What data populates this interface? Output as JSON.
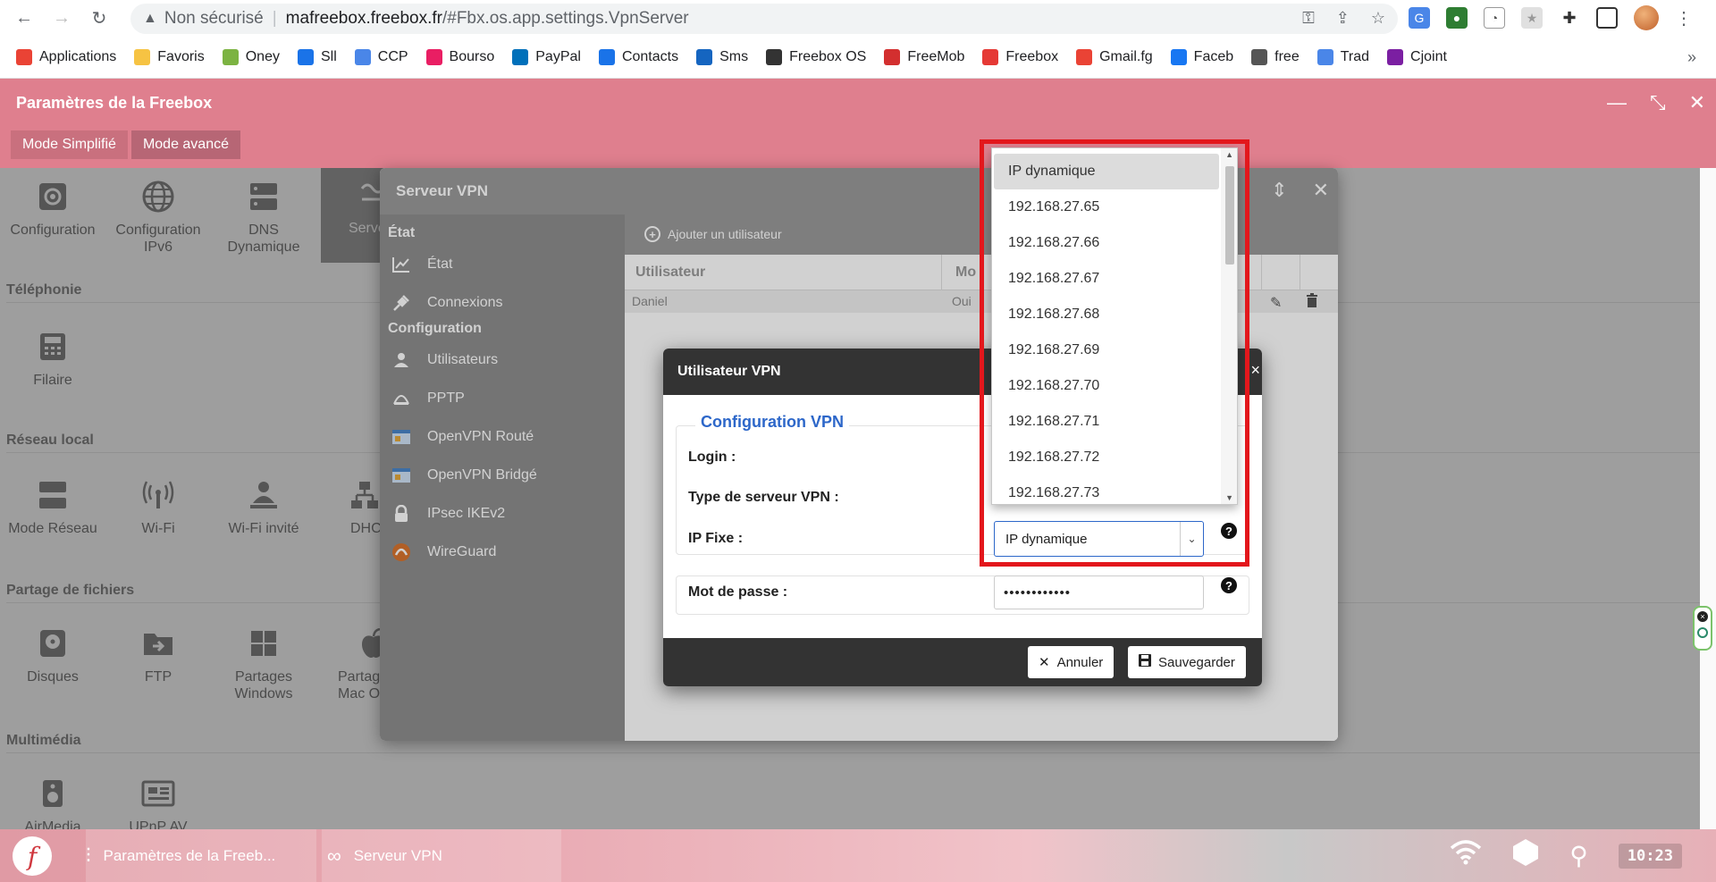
{
  "browser": {
    "insecure_label": "Non sécurisé",
    "url_host": "mafreebox.freebox.fr",
    "url_path": "/#Fbx.os.app.settings.VpnServer",
    "bookmarks": [
      "Applications",
      "Favoris",
      "Oney",
      "Sll",
      "CCP",
      "Bourso",
      "PayPal",
      "Contacts",
      "Sms",
      "Freebox OS",
      "FreeMob",
      "Freebox",
      "Gmail.fg",
      "Faceb",
      "free",
      "Trad",
      "Cjoint"
    ],
    "bookmarks_more": "»"
  },
  "app": {
    "title": "Paramètres de la Freebox",
    "mode_simple": "Mode Simplifié",
    "mode_advanced": "Mode avancé"
  },
  "settings": {
    "tiles_row1": [
      "Configuration",
      "Configuration IPv6",
      "DNS Dynamique",
      "Serveur"
    ],
    "telephony_title": "Téléphonie",
    "telephony_tiles": [
      "Filaire"
    ],
    "local_title": "Réseau local",
    "local_tiles": [
      "Mode Réseau",
      "Wi-Fi",
      "Wi-Fi invité",
      "DHC"
    ],
    "sharing_title": "Partage de fichiers",
    "sharing_tiles": [
      "Disques",
      "FTP",
      "Partages Windows",
      "Partag Mac O"
    ],
    "multimedia_title": "Multimédia",
    "multimedia_tiles": [
      "AirMedia",
      "UPnP AV"
    ]
  },
  "vpn": {
    "title": "Serveur VPN",
    "sidebar_state": "État",
    "state_items": [
      "État",
      "Connexions"
    ],
    "sidebar_config": "Configuration",
    "config_items": [
      "Utilisateurs",
      "PPTP",
      "OpenVPN Routé",
      "OpenVPN Bridgé",
      "IPsec IKEv2",
      "WireGuard"
    ],
    "add_user": "Ajouter un utilisateur",
    "col_user": "Utilisateur",
    "col_mode": "Mo",
    "row_user": "Daniel",
    "row_mode": "Oui"
  },
  "dialog": {
    "title": "Utilisateur VPN",
    "legend": "Configuration VPN",
    "login_label": "Login :",
    "server_type_label": "Type de serveur VPN :",
    "ip_label": "IP Fixe :",
    "ip_value": "IP dynamique",
    "password_label": "Mot de passe :",
    "password_value": "••••••••••••",
    "cancel": "Annuler",
    "save": "Sauvegarder",
    "close_glyph": "×"
  },
  "dropdown": {
    "options": [
      "IP dynamique",
      "192.168.27.65",
      "192.168.27.66",
      "192.168.27.67",
      "192.168.27.68",
      "192.168.27.69",
      "192.168.27.70",
      "192.168.27.71",
      "192.168.27.72",
      "192.168.27.73"
    ],
    "selected_index": 0
  },
  "taskbar": {
    "item1": "Paramètres de la Freeb...",
    "item2": "Serveur VPN",
    "clock": "10:23"
  },
  "colors": {
    "header": "#df7f8e",
    "accent_blue": "#2d67c9",
    "highlight_red": "#e3171c"
  }
}
